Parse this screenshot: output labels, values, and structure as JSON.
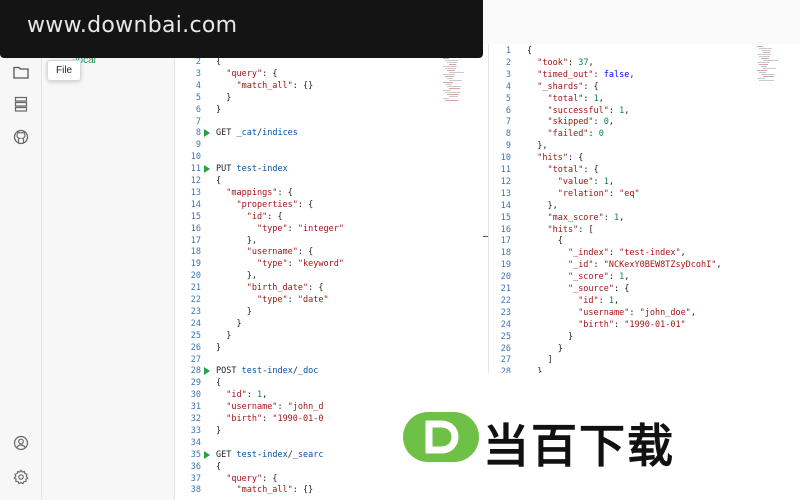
{
  "watermark": {
    "text": "www.downbai.com",
    "logo_text": "当百下载"
  },
  "sidebar": {
    "tooltip": "File",
    "connection_label": "-local"
  },
  "activity_bar": {
    "icons": [
      "folder-icon",
      "database-icon",
      "github-icon",
      "account-icon",
      "settings-icon"
    ]
  },
  "colors": {
    "accent_green": "#2ea043",
    "line_number": "#3a74b8",
    "connection_text": "#1b9a4a",
    "logo_green": "#6ec046"
  },
  "request_editor": {
    "lines": [
      {
        "n": "2",
        "t": "{",
        "run": false
      },
      {
        "n": "3",
        "t": "  \"query\": {",
        "run": false
      },
      {
        "n": "4",
        "t": "    \"match_all\": {}",
        "run": false
      },
      {
        "n": "5",
        "t": "  }",
        "run": false
      },
      {
        "n": "6",
        "t": "}",
        "run": false
      },
      {
        "n": "7",
        "t": "",
        "run": false
      },
      {
        "n": "8",
        "t": "GET _cat/indices",
        "run": true
      },
      {
        "n": "9",
        "t": "",
        "run": false
      },
      {
        "n": "10",
        "t": "",
        "run": false
      },
      {
        "n": "11",
        "t": "PUT test-index",
        "run": true
      },
      {
        "n": "12",
        "t": "{",
        "run": false
      },
      {
        "n": "13",
        "t": "  \"mappings\": {",
        "run": false
      },
      {
        "n": "14",
        "t": "    \"properties\": {",
        "run": false
      },
      {
        "n": "15",
        "t": "      \"id\": {",
        "run": false
      },
      {
        "n": "16",
        "t": "        \"type\": \"integer\"",
        "run": false
      },
      {
        "n": "17",
        "t": "      },",
        "run": false
      },
      {
        "n": "18",
        "t": "      \"username\": {",
        "run": false
      },
      {
        "n": "19",
        "t": "        \"type\": \"keyword\"",
        "run": false
      },
      {
        "n": "20",
        "t": "      },",
        "run": false
      },
      {
        "n": "21",
        "t": "      \"birth_date\": {",
        "run": false
      },
      {
        "n": "22",
        "t": "        \"type\": \"date\"",
        "run": false
      },
      {
        "n": "23",
        "t": "      }",
        "run": false
      },
      {
        "n": "24",
        "t": "    }",
        "run": false
      },
      {
        "n": "25",
        "t": "  }",
        "run": false
      },
      {
        "n": "26",
        "t": "}",
        "run": false
      },
      {
        "n": "27",
        "t": "",
        "run": false
      },
      {
        "n": "28",
        "t": "POST test-index/_doc",
        "run": true
      },
      {
        "n": "29",
        "t": "{",
        "run": false
      },
      {
        "n": "30",
        "t": "  \"id\": 1,",
        "run": false
      },
      {
        "n": "31",
        "t": "  \"username\": \"john_d",
        "run": false
      },
      {
        "n": "32",
        "t": "  \"birth\": \"1990-01-0",
        "run": false
      },
      {
        "n": "33",
        "t": "}",
        "run": false
      },
      {
        "n": "34",
        "t": "",
        "run": false
      },
      {
        "n": "35",
        "t": "GET test-index/_searc",
        "run": true
      },
      {
        "n": "36",
        "t": "{",
        "run": false
      },
      {
        "n": "37",
        "t": "  \"query\": {",
        "run": false
      },
      {
        "n": "38",
        "t": "    \"match_all\": {}",
        "run": false
      }
    ]
  },
  "response_viewer": {
    "lines": [
      {
        "n": "1",
        "t": "{"
      },
      {
        "n": "2",
        "t": "  \"took\": 37,"
      },
      {
        "n": "3",
        "t": "  \"timed_out\": false,"
      },
      {
        "n": "4",
        "t": "  \"_shards\": {"
      },
      {
        "n": "5",
        "t": "    \"total\": 1,"
      },
      {
        "n": "6",
        "t": "    \"successful\": 1,"
      },
      {
        "n": "7",
        "t": "    \"skipped\": 0,"
      },
      {
        "n": "8",
        "t": "    \"failed\": 0"
      },
      {
        "n": "9",
        "t": "  },"
      },
      {
        "n": "10",
        "t": "  \"hits\": {"
      },
      {
        "n": "11",
        "t": "    \"total\": {"
      },
      {
        "n": "12",
        "t": "      \"value\": 1,"
      },
      {
        "n": "13",
        "t": "      \"relation\": \"eq\""
      },
      {
        "n": "14",
        "t": "    },"
      },
      {
        "n": "15",
        "t": "    \"max_score\": 1,"
      },
      {
        "n": "16",
        "t": "    \"hits\": ["
      },
      {
        "n": "17",
        "t": "      {"
      },
      {
        "n": "18",
        "t": "        \"_index\": \"test-index\","
      },
      {
        "n": "19",
        "t": "        \"_id\": \"NCKexY0BEW8TZsyDcohI\","
      },
      {
        "n": "20",
        "t": "        \"_score\": 1,"
      },
      {
        "n": "21",
        "t": "        \"_source\": {"
      },
      {
        "n": "22",
        "t": "          \"id\": 1,"
      },
      {
        "n": "23",
        "t": "          \"username\": \"john_doe\","
      },
      {
        "n": "24",
        "t": "          \"birth\": \"1990-01-01\""
      },
      {
        "n": "25",
        "t": "        }"
      },
      {
        "n": "26",
        "t": "      }"
      },
      {
        "n": "27",
        "t": "    ]"
      },
      {
        "n": "28",
        "t": "  }"
      }
    ]
  }
}
